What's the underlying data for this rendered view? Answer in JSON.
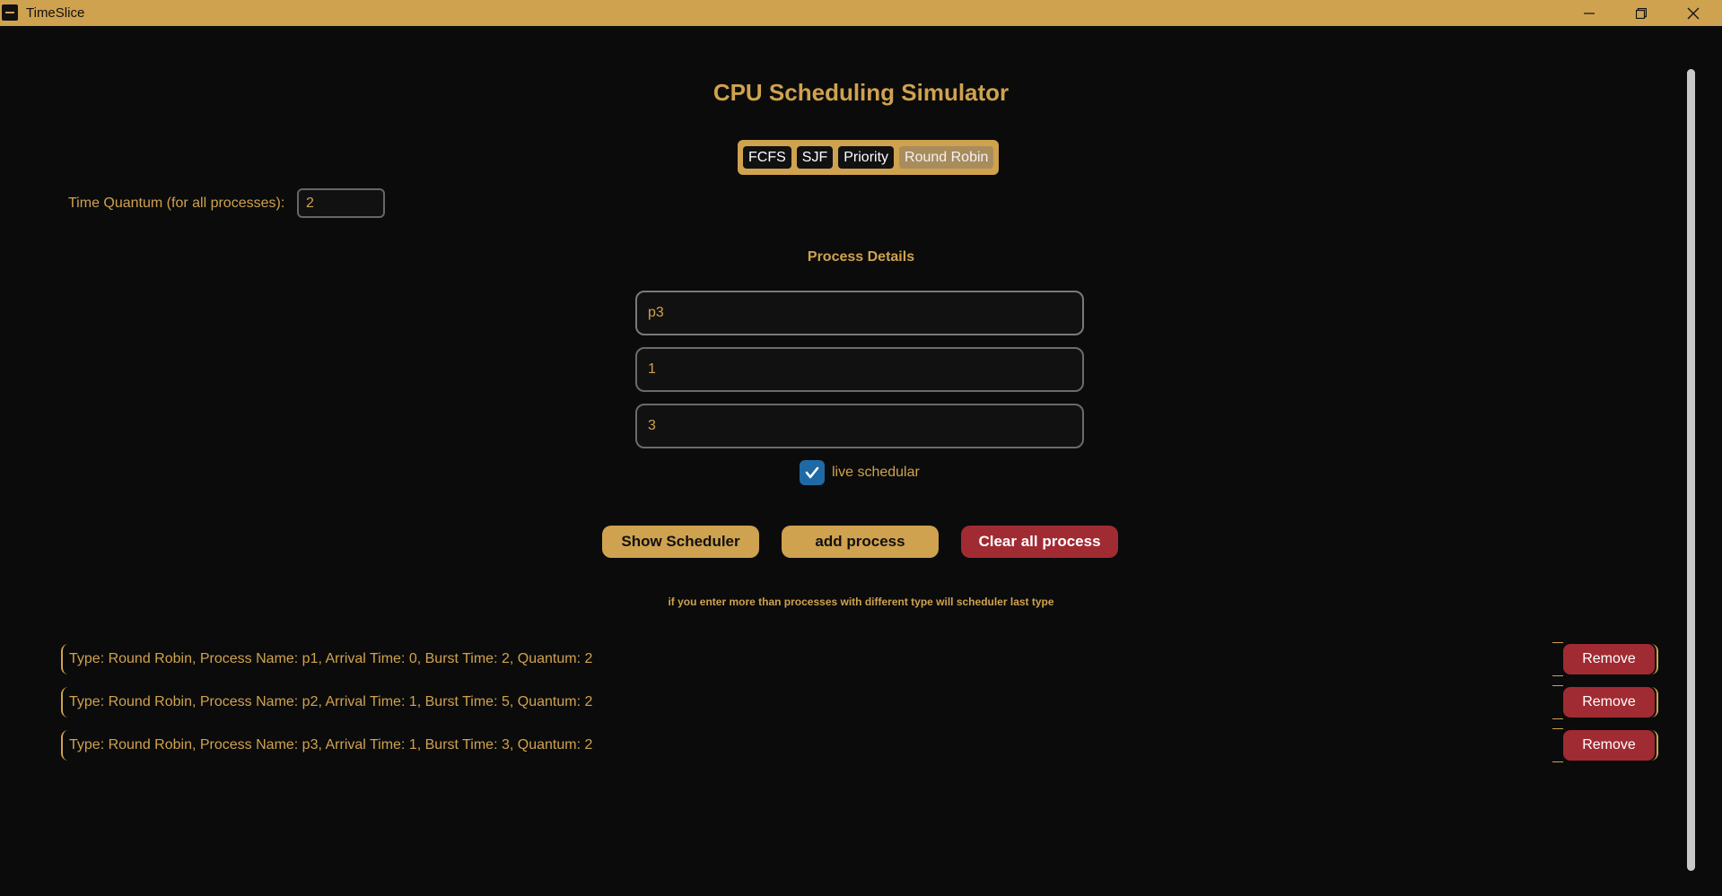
{
  "window": {
    "title": "TimeSlice",
    "minimize_icon": "minimize-icon",
    "maximize_icon": "restore-icon",
    "close_icon": "close-icon"
  },
  "header": {
    "title": "CPU Scheduling Simulator"
  },
  "algorithm_tabs": [
    {
      "label": "FCFS",
      "active": false
    },
    {
      "label": "SJF",
      "active": false
    },
    {
      "label": "Priority",
      "active": false
    },
    {
      "label": "Round Robin",
      "active": true
    }
  ],
  "quantum": {
    "label": "Time Quantum (for all processes):",
    "value": "2"
  },
  "process_details": {
    "title": "Process Details",
    "name_value": "p3",
    "arrival_value": "1",
    "burst_value": "3"
  },
  "live_scheduler": {
    "label": "live schedular",
    "checked": true
  },
  "actions": {
    "show_scheduler": "Show Scheduler",
    "add_process": "add process",
    "clear_all": "Clear all process"
  },
  "hint": "if you enter more than processes with different type will scheduler last type",
  "processes": [
    {
      "text": "Type: Round Robin, Process Name: p1, Arrival Time: 0, Burst Time: 2, Quantum: 2",
      "remove_label": "Remove"
    },
    {
      "text": "Type: Round Robin, Process Name: p2, Arrival Time: 1, Burst Time: 5, Quantum: 2",
      "remove_label": "Remove"
    },
    {
      "text": "Type: Round Robin, Process Name: p3, Arrival Time: 1, Burst Time: 3, Quantum: 2",
      "remove_label": "Remove"
    }
  ],
  "colors": {
    "accent": "#cfa24f",
    "background": "#0b0b0b",
    "danger": "#a12b32",
    "checkbox": "#1f6aa5"
  }
}
